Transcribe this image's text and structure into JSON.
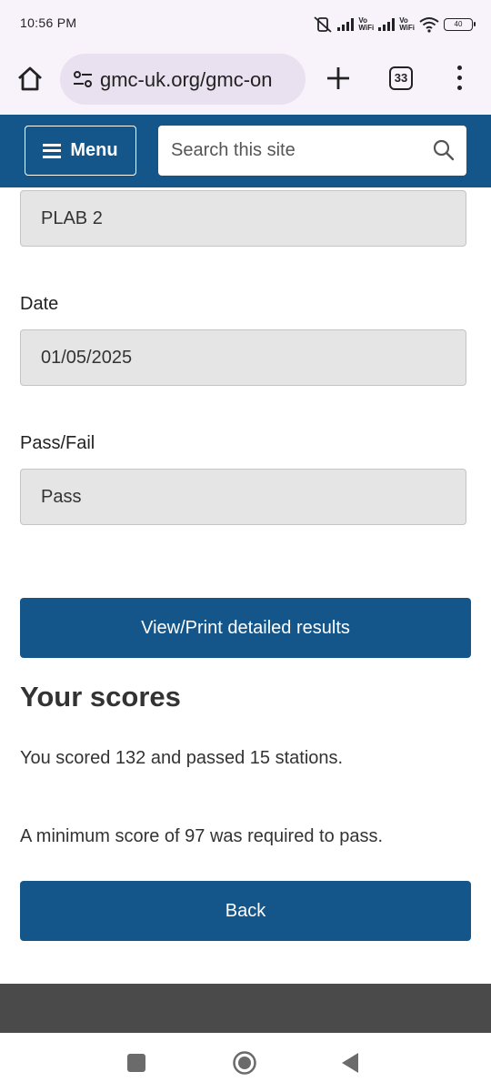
{
  "status_bar": {
    "time": "10:56 PM",
    "vowifi_1": "Vo\nWiFi",
    "vowifi_2": "Vo\nWiFi",
    "battery": "40"
  },
  "browser": {
    "url": "gmc-uk.org/gmc-on",
    "tab_count": "33",
    "icons": [
      "home-icon",
      "site-settings-icon",
      "plus-icon",
      "tabs-icon",
      "more-vert-icon"
    ]
  },
  "site_header": {
    "menu_label": "Menu",
    "search_placeholder": "Search this site",
    "background_color": "#14568a"
  },
  "results": {
    "exam_value": "PLAB 2",
    "date_label": "Date",
    "date_value": "01/05/2025",
    "passfail_label": "Pass/Fail",
    "passfail_value": "Pass",
    "view_print_label": "View/Print detailed results",
    "scores_heading": "Your scores",
    "score_text": "You scored 132 and passed 15 stations.",
    "minimum_text": "A minimum score of 97 was required to pass.",
    "back_label": "Back"
  },
  "nav_bar": {
    "icons": [
      "recents-icon",
      "home-circle-icon",
      "back-triangle-icon"
    ]
  }
}
